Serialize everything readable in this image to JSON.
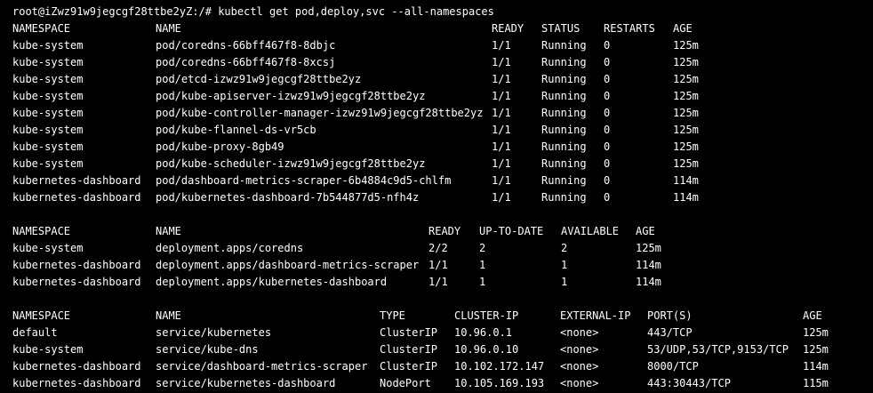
{
  "terminal": {
    "prompt": "root@iZwz91w9jegcgf28ttbe2yZ:/#",
    "command": "kubectl get pod,deploy,svc --all-namespaces"
  },
  "pods": {
    "headers": [
      "NAMESPACE",
      "NAME",
      "READY",
      "STATUS",
      "RESTARTS",
      "AGE"
    ],
    "rows": [
      [
        "kube-system",
        "pod/coredns-66bff467f8-8dbjc",
        "1/1",
        "Running",
        "0",
        "125m"
      ],
      [
        "kube-system",
        "pod/coredns-66bff467f8-8xcsj",
        "1/1",
        "Running",
        "0",
        "125m"
      ],
      [
        "kube-system",
        "pod/etcd-izwz91w9jegcgf28ttbe2yz",
        "1/1",
        "Running",
        "0",
        "125m"
      ],
      [
        "kube-system",
        "pod/kube-apiserver-izwz91w9jegcgf28ttbe2yz",
        "1/1",
        "Running",
        "0",
        "125m"
      ],
      [
        "kube-system",
        "pod/kube-controller-manager-izwz91w9jegcgf28ttbe2yz",
        "1/1",
        "Running",
        "0",
        "125m"
      ],
      [
        "kube-system",
        "pod/kube-flannel-ds-vr5cb",
        "1/1",
        "Running",
        "0",
        "125m"
      ],
      [
        "kube-system",
        "pod/kube-proxy-8gb49",
        "1/1",
        "Running",
        "0",
        "125m"
      ],
      [
        "kube-system",
        "pod/kube-scheduler-izwz91w9jegcgf28ttbe2yz",
        "1/1",
        "Running",
        "0",
        "125m"
      ],
      [
        "kubernetes-dashboard",
        "pod/dashboard-metrics-scraper-6b4884c9d5-chlfm",
        "1/1",
        "Running",
        "0",
        "114m"
      ],
      [
        "kubernetes-dashboard",
        "pod/kubernetes-dashboard-7b544877d5-nfh4z",
        "1/1",
        "Running",
        "0",
        "114m"
      ]
    ]
  },
  "deployments": {
    "headers": [
      "NAMESPACE",
      "NAME",
      "READY",
      "UP-TO-DATE",
      "AVAILABLE",
      "AGE"
    ],
    "rows": [
      [
        "kube-system",
        "deployment.apps/coredns",
        "2/2",
        "2",
        "2",
        "125m"
      ],
      [
        "kubernetes-dashboard",
        "deployment.apps/dashboard-metrics-scraper",
        "1/1",
        "1",
        "1",
        "114m"
      ],
      [
        "kubernetes-dashboard",
        "deployment.apps/kubernetes-dashboard",
        "1/1",
        "1",
        "1",
        "114m"
      ]
    ]
  },
  "services": {
    "headers": [
      "NAMESPACE",
      "NAME",
      "TYPE",
      "CLUSTER-IP",
      "EXTERNAL-IP",
      "PORT(S)",
      "AGE"
    ],
    "rows": [
      [
        "default",
        "service/kubernetes",
        "ClusterIP",
        "10.96.0.1",
        "<none>",
        "443/TCP",
        "125m"
      ],
      [
        "kube-system",
        "service/kube-dns",
        "ClusterIP",
        "10.96.0.10",
        "<none>",
        "53/UDP,53/TCP,9153/TCP",
        "125m"
      ],
      [
        "kubernetes-dashboard",
        "service/dashboard-metrics-scraper",
        "ClusterIP",
        "10.102.172.147",
        "<none>",
        "8000/TCP",
        "114m"
      ],
      [
        "kubernetes-dashboard",
        "service/kubernetes-dashboard",
        "NodePort",
        "10.105.169.193",
        "<none>",
        "443:30443/TCP",
        "115m"
      ]
    ]
  },
  "colors": {
    "background": "#000000",
    "foreground": "#ffffff"
  }
}
